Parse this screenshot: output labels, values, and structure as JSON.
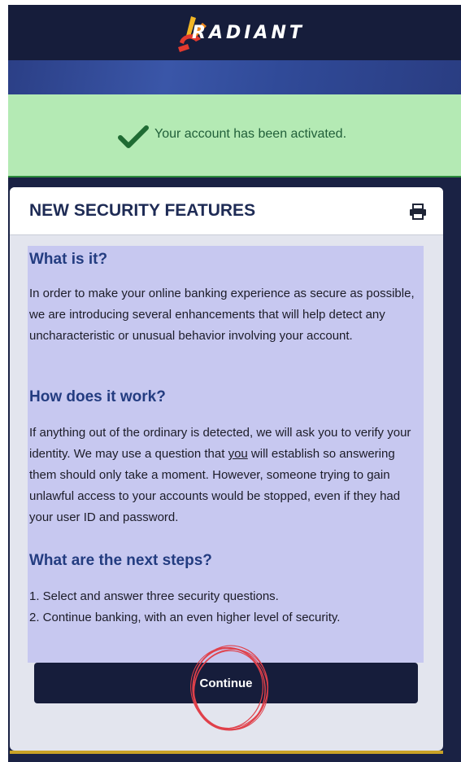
{
  "header": {
    "brand_name": "RADIANT",
    "logo_icon": "radiant-sunburst-logo"
  },
  "alert": {
    "icon": "checkmark-icon",
    "message": "Your account has been activated.",
    "color": "#b4eab4"
  },
  "card": {
    "title": "NEW SECURITY FEATURES",
    "print_icon": "printer-icon",
    "sections": [
      {
        "heading": "What is it?",
        "body": "In order to make your online banking experience as secure as possible, we are introducing several enhancements that will help detect any uncharacteristic or unusual behavior involving your account."
      },
      {
        "heading": "How does it work?",
        "body_parts": [
          "If anything out of the ordinary is detected, we will ask you to verify your identity. We may use a question that ",
          "you",
          " will establish so answering them should only take a moment. However, someone trying to gain unlawful access to your accounts would be stopped, even if they had your user ID and password."
        ]
      },
      {
        "heading": "What are the next steps?",
        "steps": [
          "1. Select and answer three security questions.",
          "2. Continue banking, with an even higher level of security."
        ]
      }
    ],
    "continue_label": "Continue"
  },
  "colors": {
    "navy": "#161d3b",
    "accent_blue": "#233c80",
    "highlight": "#c7c8f0",
    "success_green": "#2c8a3c",
    "annotation_red": "#e0404a"
  }
}
